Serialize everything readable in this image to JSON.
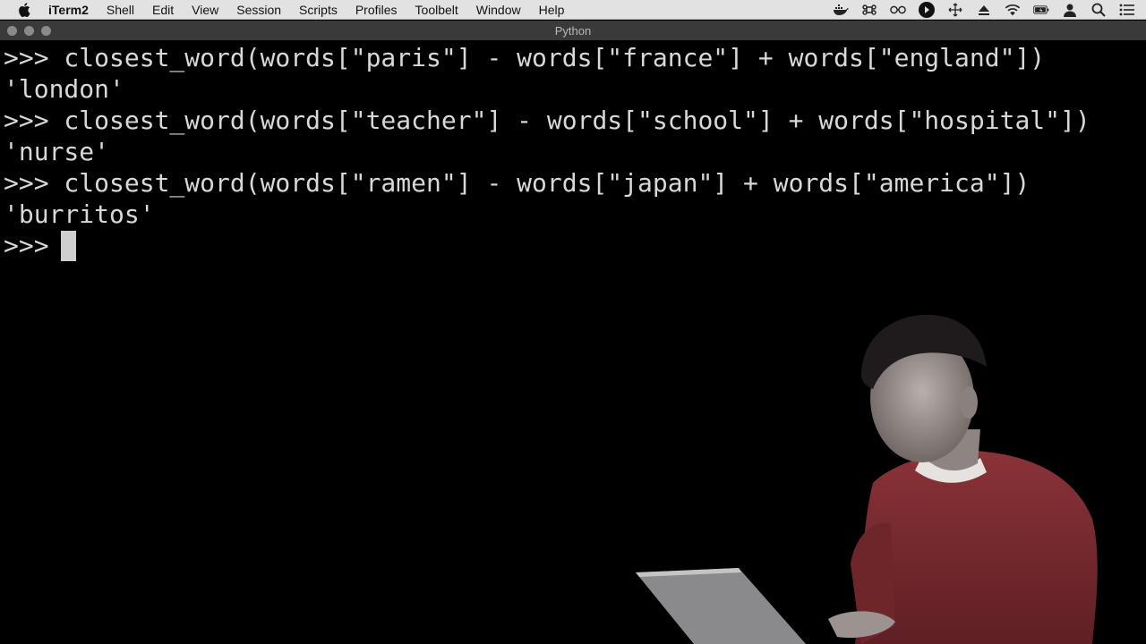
{
  "menubar": {
    "app_name": "iTerm2",
    "items": [
      "Shell",
      "Edit",
      "View",
      "Session",
      "Scripts",
      "Profiles",
      "Toolbelt",
      "Window",
      "Help"
    ],
    "status_icons": [
      "docker-icon",
      "command-icon",
      "glasses-icon",
      "play-icon",
      "move-icon",
      "eject-icon",
      "wifi-icon",
      "battery-icon",
      "user-icon",
      "search-icon",
      "list-icon"
    ]
  },
  "window": {
    "title": "Python"
  },
  "terminal": {
    "lines": [
      ">>> closest_word(words[\"paris\"] - words[\"france\"] + words[\"england\"])",
      "'london'",
      ">>> closest_word(words[\"teacher\"] - words[\"school\"] + words[\"hospital\"])",
      "'nurse'",
      ">>> closest_word(words[\"ramen\"] - words[\"japan\"] + words[\"america\"])",
      "'burritos'",
      ">>> "
    ]
  },
  "colors": {
    "terminal_bg": "#000000",
    "terminal_fg": "#d8d8d8",
    "menubar_bg": "#e2e2e2",
    "titlebar_bg": "#3a3a3a",
    "shirt": "#7a2a30"
  }
}
